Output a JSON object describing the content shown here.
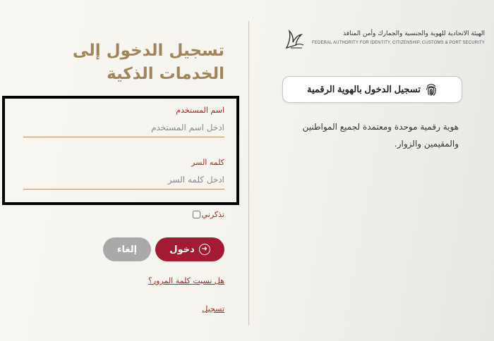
{
  "login": {
    "title": "تسجيل الدخول إلى الخدمات الذكية",
    "username": {
      "label": "اسم المستخدم",
      "placeholder": "ادخل اسم المستخدم",
      "value": ""
    },
    "password": {
      "label": "كلمه السر",
      "placeholder": "ادخل كلمه السر",
      "value": ""
    },
    "remember_label": "تذكرني",
    "remember_checked": false,
    "login_button": "دخول",
    "cancel_button": "إلغاء",
    "forgot_link": "هل نسيت كلمة المرور؟",
    "register_link": "تسجيل"
  },
  "authority": {
    "name_ar": "الهيئة الاتحادية للهوية والجنسية والجمارك وأمن المنافذ",
    "name_en": "FEDERAL AUTHORITY FOR IDENTITY, CITIZENSHIP, CUSTOMS & PORT SECURITY"
  },
  "digital_id": {
    "button_label": "تسجيل الدخول بالهوية الرقمية",
    "description": "هوية رقمية موحدة ومعتمدة لجميع المواطنين والمقيمين والزوار."
  },
  "colors": {
    "title": "#a0845c",
    "accent": "#a31b32",
    "link": "#a52a2a",
    "cancel": "#a9a9a9",
    "highlight_box": "#000000"
  },
  "icons": [
    "falcon-emblem-icon",
    "fingerprint-icon",
    "login-arrow-icon"
  ]
}
